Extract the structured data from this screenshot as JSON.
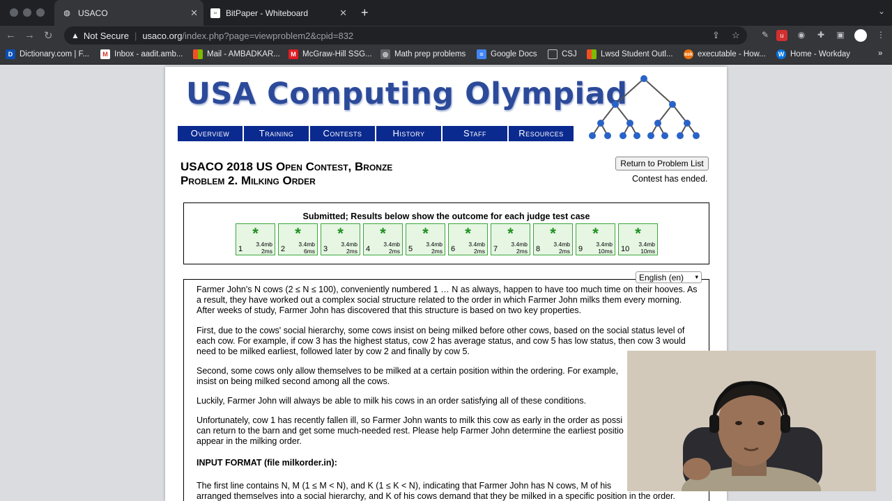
{
  "browser": {
    "tabs": [
      {
        "label": "USACO",
        "active": true
      },
      {
        "label": "BitPaper - Whiteboard",
        "active": false
      }
    ],
    "security_label": "Not Secure",
    "url_host": "usaco.org",
    "url_path": "/index.php?page=viewproblem2&cpid=832",
    "bookmarks": [
      {
        "label": "Dictionary.com | F...",
        "icon": "D",
        "color": "#0a4fb5"
      },
      {
        "label": "Inbox - aadit.amb...",
        "icon": "M",
        "color": "#d93025"
      },
      {
        "label": "Mail - AMBADKAR...",
        "icon": "■",
        "color": "#f25022"
      },
      {
        "label": "McGraw-Hill SSG...",
        "icon": "M",
        "color": "#e31b23"
      },
      {
        "label": "Math prep problems",
        "icon": "◎",
        "color": "#5f6368"
      },
      {
        "label": "Google Docs",
        "icon": "≡",
        "color": "#4285f4"
      },
      {
        "label": "CSJ",
        "icon": "▭",
        "color": "#5f6368"
      },
      {
        "label": "Lwsd Student Outl...",
        "icon": "■",
        "color": "#f25022"
      },
      {
        "label": "executable - How...",
        "icon": "ex",
        "color": "#e8710a"
      },
      {
        "label": "Home - Workday",
        "icon": "W",
        "color": "#0875e1"
      }
    ]
  },
  "site": {
    "logo": "USA Computing Olympiad",
    "menu": [
      "Overview",
      "Training",
      "Contests",
      "History",
      "Staff",
      "Resources"
    ]
  },
  "problem": {
    "contest": "USACO 2018 US Open Contest, Bronze",
    "name": "Problem 2. Milking Order",
    "return_button": "Return to Problem List",
    "status": "Contest has ended.",
    "results_header": "Submitted; Results below show the outcome for each judge test case",
    "language": "English (en)",
    "tests": [
      {
        "n": "1",
        "mem": "3.4mb",
        "time": "2ms"
      },
      {
        "n": "2",
        "mem": "3.4mb",
        "time": "6ms"
      },
      {
        "n": "3",
        "mem": "3.4mb",
        "time": "2ms"
      },
      {
        "n": "4",
        "mem": "3.4mb",
        "time": "2ms"
      },
      {
        "n": "5",
        "mem": "3.4mb",
        "time": "2ms"
      },
      {
        "n": "6",
        "mem": "3.4mb",
        "time": "2ms"
      },
      {
        "n": "7",
        "mem": "3.4mb",
        "time": "2ms"
      },
      {
        "n": "8",
        "mem": "3.4mb",
        "time": "2ms"
      },
      {
        "n": "9",
        "mem": "3.4mb",
        "time": "10ms"
      },
      {
        "n": "10",
        "mem": "3.4mb",
        "time": "10ms"
      }
    ],
    "paragraphs": [
      "Farmer John's N cows (2 ≤ N ≤ 100), conveniently numbered 1 … N as always, happen to have too much time on their hooves. As a result, they have worked out a complex social structure related to the order in which Farmer John milks them every morning. After weeks of study, Farmer John has discovered that this structure is based on two key properties.",
      "First, due to the cows' social hierarchy, some cows insist on being milked before other cows, based on the social status level of each cow. For example, if cow 3 has the highest status, cow 2 has average status, and cow 5 has low status, then cow 3 would need to be milked earliest, followed later by cow 2 and finally by cow 5.",
      "Second, some cows only allow themselves to be milked at a certain position within the ordering. For example,",
      "insist on being milked second among all the cows.",
      "Luckily, Farmer John will always be able to milk his cows in an order satisfying all of these conditions.",
      "Unfortunately, cow 1 has recently fallen ill, so Farmer John wants to milk this cow as early in the order as possi",
      "can return to the barn and get some much-needed rest. Please help Farmer John determine the earliest positio",
      "appear in the milking order.",
      "INPUT FORMAT (file milkorder.in):",
      "The first line contains N, M (1 ≤ M < N), and K (1 ≤ K < N), indicating that Farmer John has N cows, M of his",
      "arranged themselves into a social hierarchy, and K of his cows demand that they be milked in a specific position in the order."
    ]
  }
}
